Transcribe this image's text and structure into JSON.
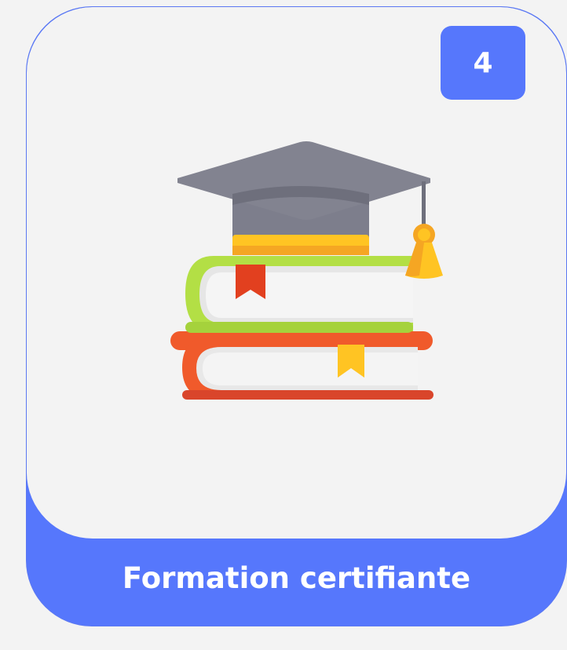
{
  "card": {
    "step_number": "4",
    "title": "Formation certifiante",
    "icon": "graduation-cap-books-icon",
    "accent_color": "#5677fc"
  }
}
